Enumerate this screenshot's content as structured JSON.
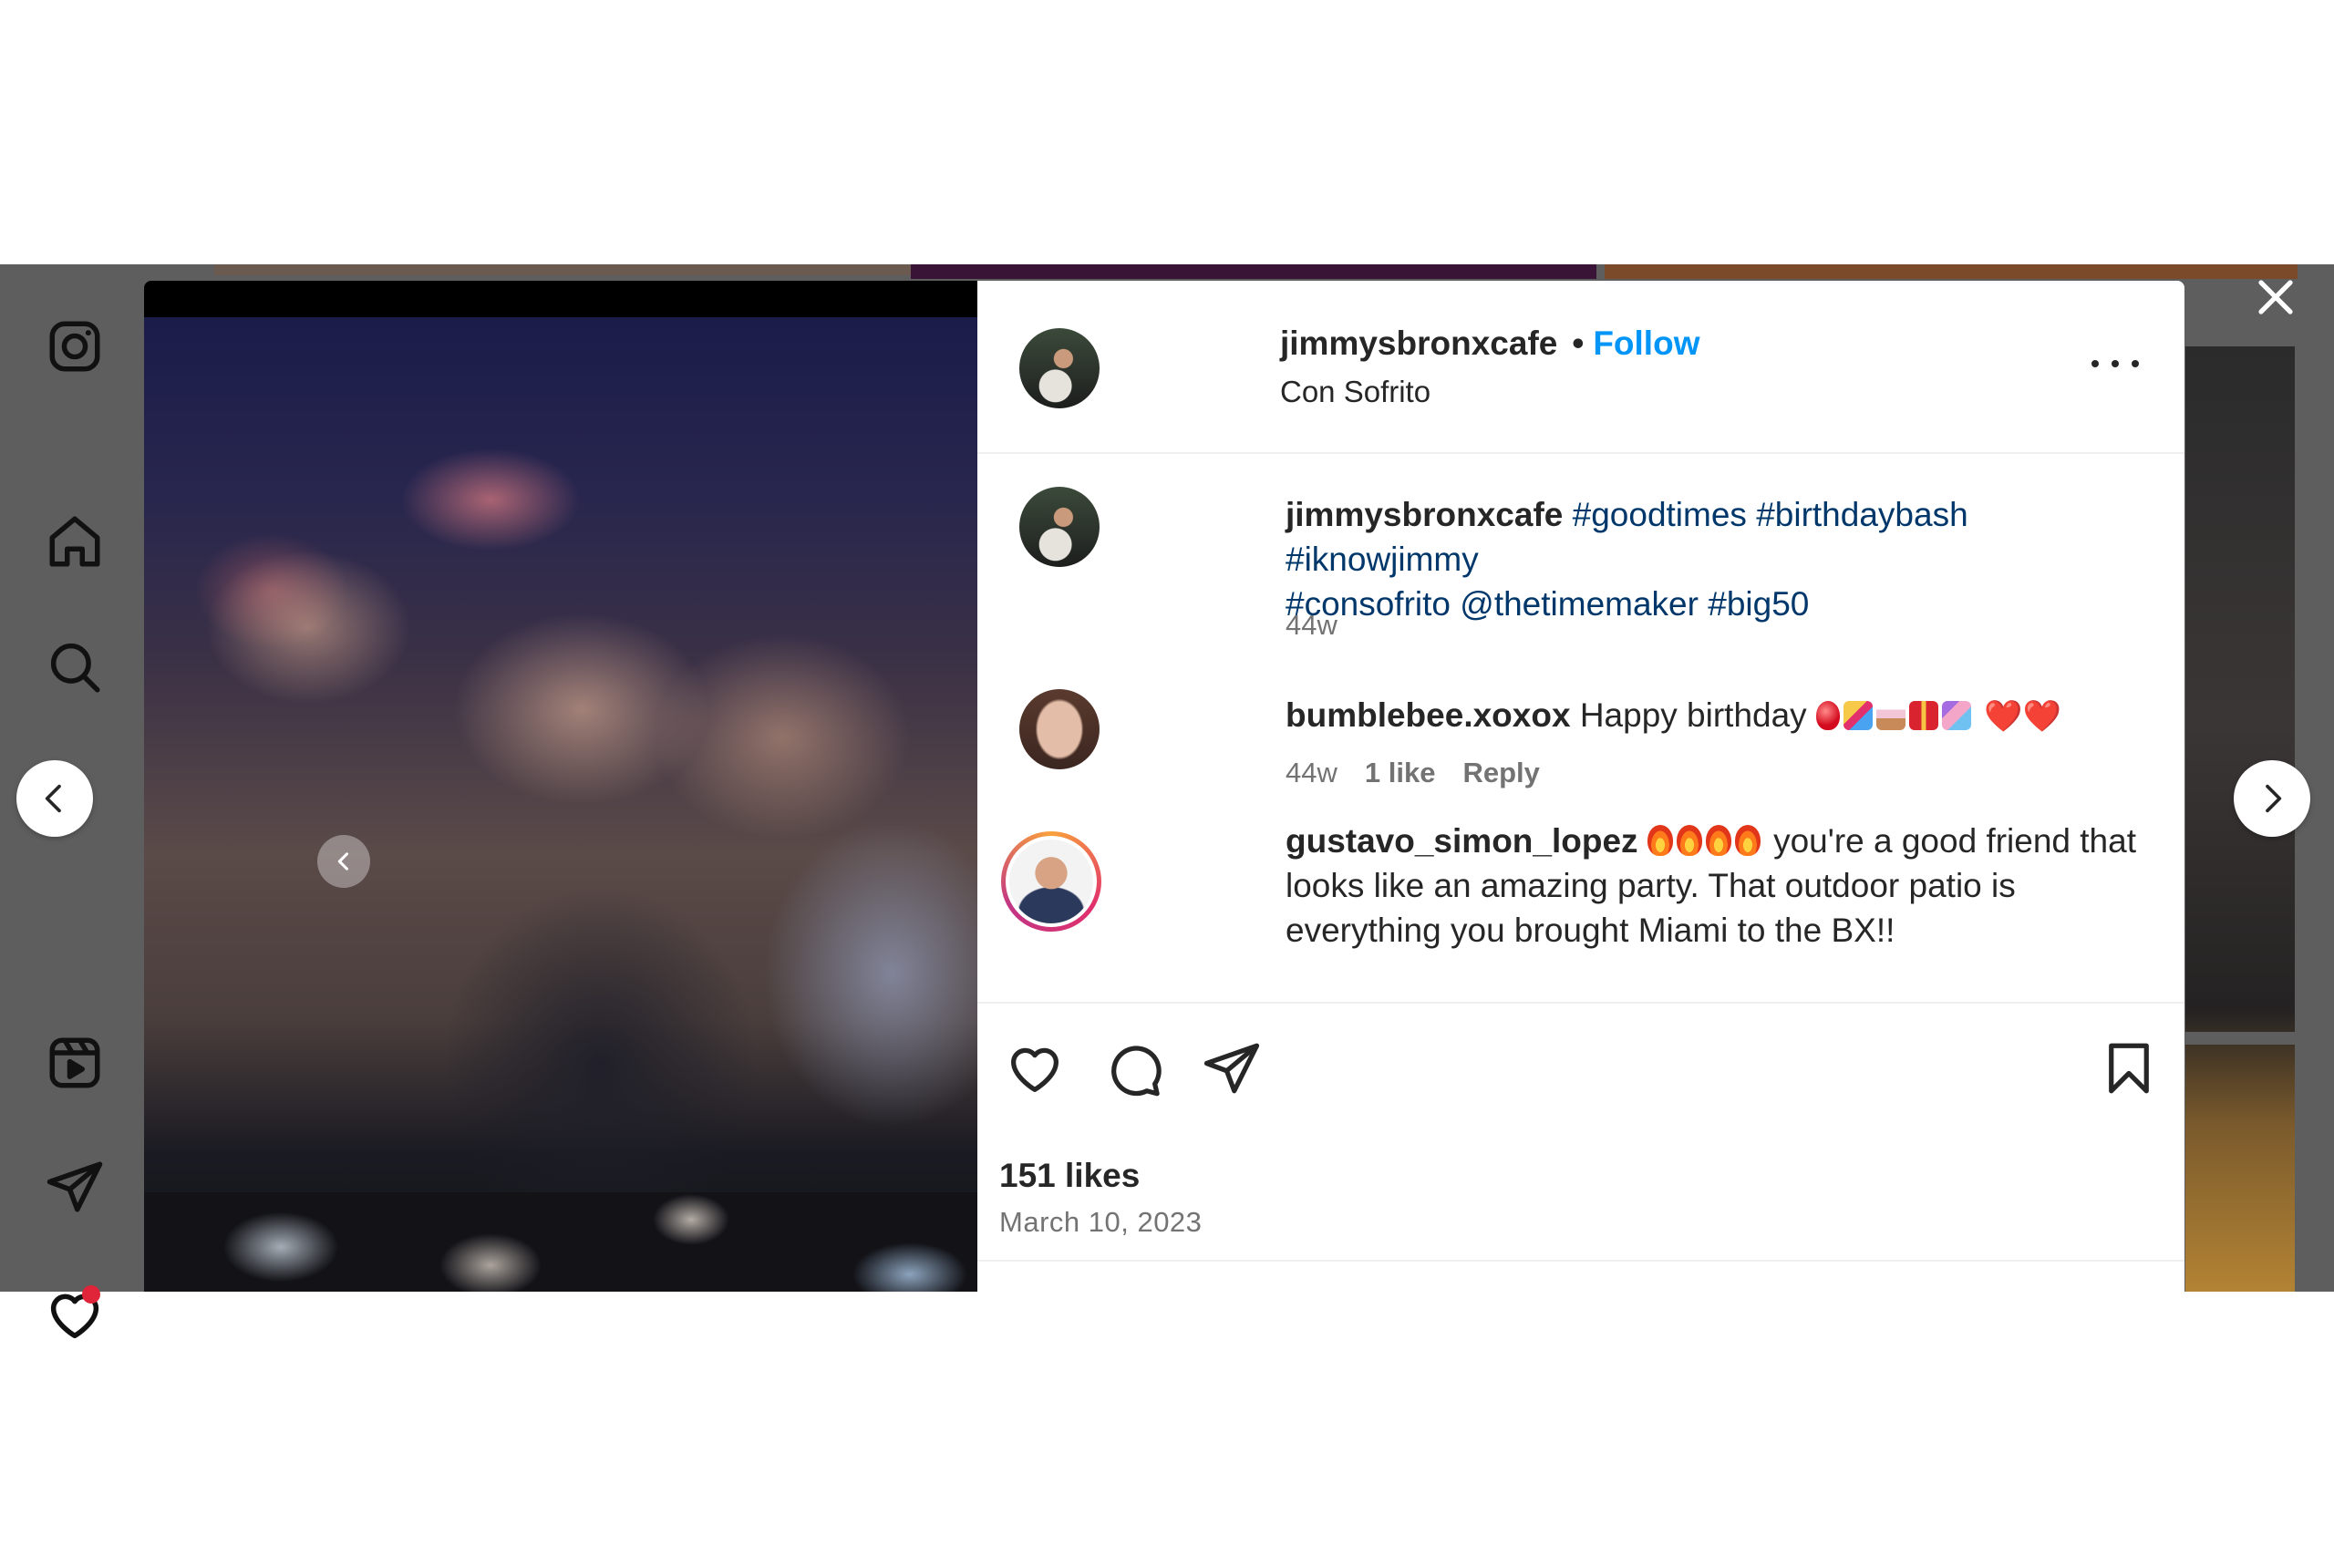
{
  "post": {
    "username": "jimmysbronxcafe",
    "follow_label": "Follow",
    "separator": "•",
    "location": "Con Sofrito"
  },
  "caption": {
    "username": "jimmysbronxcafe",
    "text_line1": "#goodtimes #birthdaybash #iknowjimmy",
    "text_line2": "#consofrito @thetimemaker #big50",
    "time": "44w"
  },
  "comments": [
    {
      "username": "bumblebee.xoxox",
      "text": "Happy birthday",
      "emojis": [
        "balloon-emoji",
        "party-popper-emoji",
        "cake-emoji",
        "gift-emoji",
        "confetti-emoji"
      ],
      "hearts": "❤️❤️",
      "time": "44w",
      "likes": "1 like",
      "reply": "Reply"
    },
    {
      "username": "gustavo_simon_lopez",
      "emojis": [
        "fire-emoji",
        "fire-emoji",
        "fire-emoji",
        "fire-emoji"
      ],
      "text_line1": "you're a good friend that",
      "text_line2": "looks like an amazing party. That outdoor patio is",
      "text_line3": "everything you brought Miami to the BX!!"
    }
  ],
  "actions": {
    "likes_count": "151 likes",
    "date": "March 10, 2023"
  },
  "icons": {
    "nav": [
      "instagram-logo-icon",
      "home-icon",
      "search-icon",
      "explore-icon",
      "reels-icon",
      "messages-icon",
      "notifications-icon"
    ],
    "post_actions": [
      "like-icon",
      "comment-icon",
      "share-icon",
      "save-icon"
    ],
    "close": "close-icon",
    "more": "more-options-icon"
  },
  "colors": {
    "follow": "#0095f6",
    "hashtag": "#00376b",
    "notification_dot": "#e0243a",
    "overlay": "#5e5e5e"
  }
}
